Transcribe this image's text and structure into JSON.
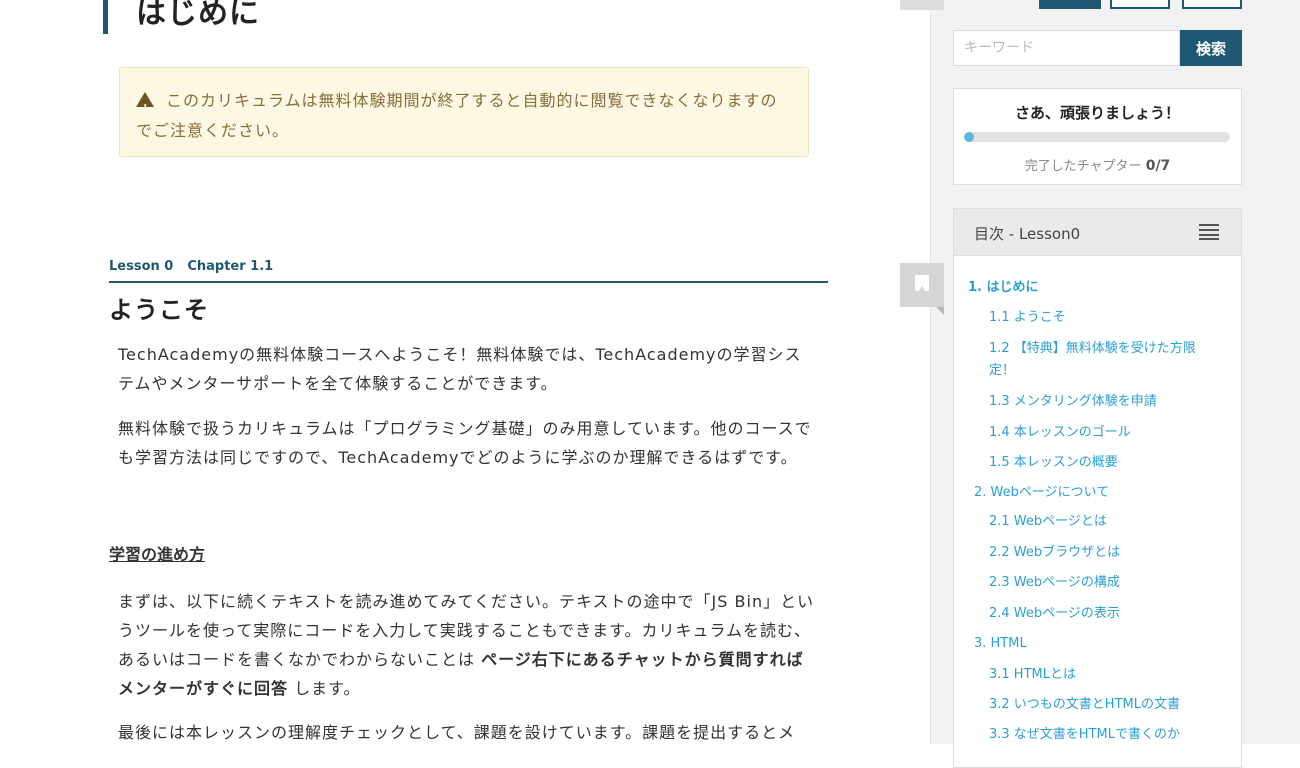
{
  "main": {
    "page_title": "はじめに",
    "notice_text": "このカリキュラムは無料体験期間が終了すると自動的に閲覧できなくなりますのでご注意ください。",
    "lesson_label": "Lesson 0",
    "chapter_label": "Chapter 1.1",
    "heading": "ようこそ",
    "para1": "TechAcademyの無料体験コースへようこそ！無料体験では、TechAcademyの学習システムやメンターサポートを全て体験することができます。",
    "para2": "無料体験で扱うカリキュラムは「プログラミング基礎」のみ用意しています。他のコースでも学習方法は同じですので、TechAcademyでどのように学ぶのか理解できるはずです。",
    "subheading": "学習の進め方",
    "para3_a": "まずは、以下に続くテキストを読み進めてみてください。テキストの途中で「JS Bin」というツールを使って実際にコードを入力して実践することもできます。カリキュラムを読む、あるいはコードを書くなかでわからないことは ",
    "para3_bold": "ページ右下にあるチャットから質問すればメンターがすぐに回答",
    "para3_b": " します。",
    "para4": "最後には本レッスンの理解度チェックとして、課題を設けています。課題を提出するとメ"
  },
  "sidebar": {
    "search_placeholder": "キーワード",
    "search_button": "検索",
    "progress": {
      "cheer": "さあ、頑張りましょう！",
      "done_label": "完了したチャプター",
      "done_count": "0/7",
      "fraction": 0.0
    },
    "toc": {
      "title": "目次 - Lesson0",
      "items": [
        {
          "label": "1. はじめに"
        },
        {
          "label": "1.1 ようこそ"
        },
        {
          "label": "1.2 【特典】無料体験を受けた方限定！"
        },
        {
          "label": "1.3 メンタリング体験を申請"
        },
        {
          "label": "1.4 本レッスンのゴール"
        },
        {
          "label": "1.5 本レッスンの概要"
        },
        {
          "label": "2. Webページについて"
        },
        {
          "label": "2.1 Webページとは"
        },
        {
          "label": "2.2 Webブラウザとは"
        },
        {
          "label": "2.3 Webページの構成"
        },
        {
          "label": "2.4 Webページの表示"
        },
        {
          "label": "3. HTML"
        },
        {
          "label": "3.1 HTMLとは"
        },
        {
          "label": "3.2 いつもの文書とHTMLの文書"
        },
        {
          "label": "3.3 なぜ文書をHTMLで書くのか"
        }
      ]
    }
  },
  "colors": {
    "brand": "#1f5872",
    "link": "#2a9fd6",
    "notice_bg": "#fcf8e3",
    "notice_text": "#8a6d3b",
    "progress": "#5bb7dc"
  }
}
